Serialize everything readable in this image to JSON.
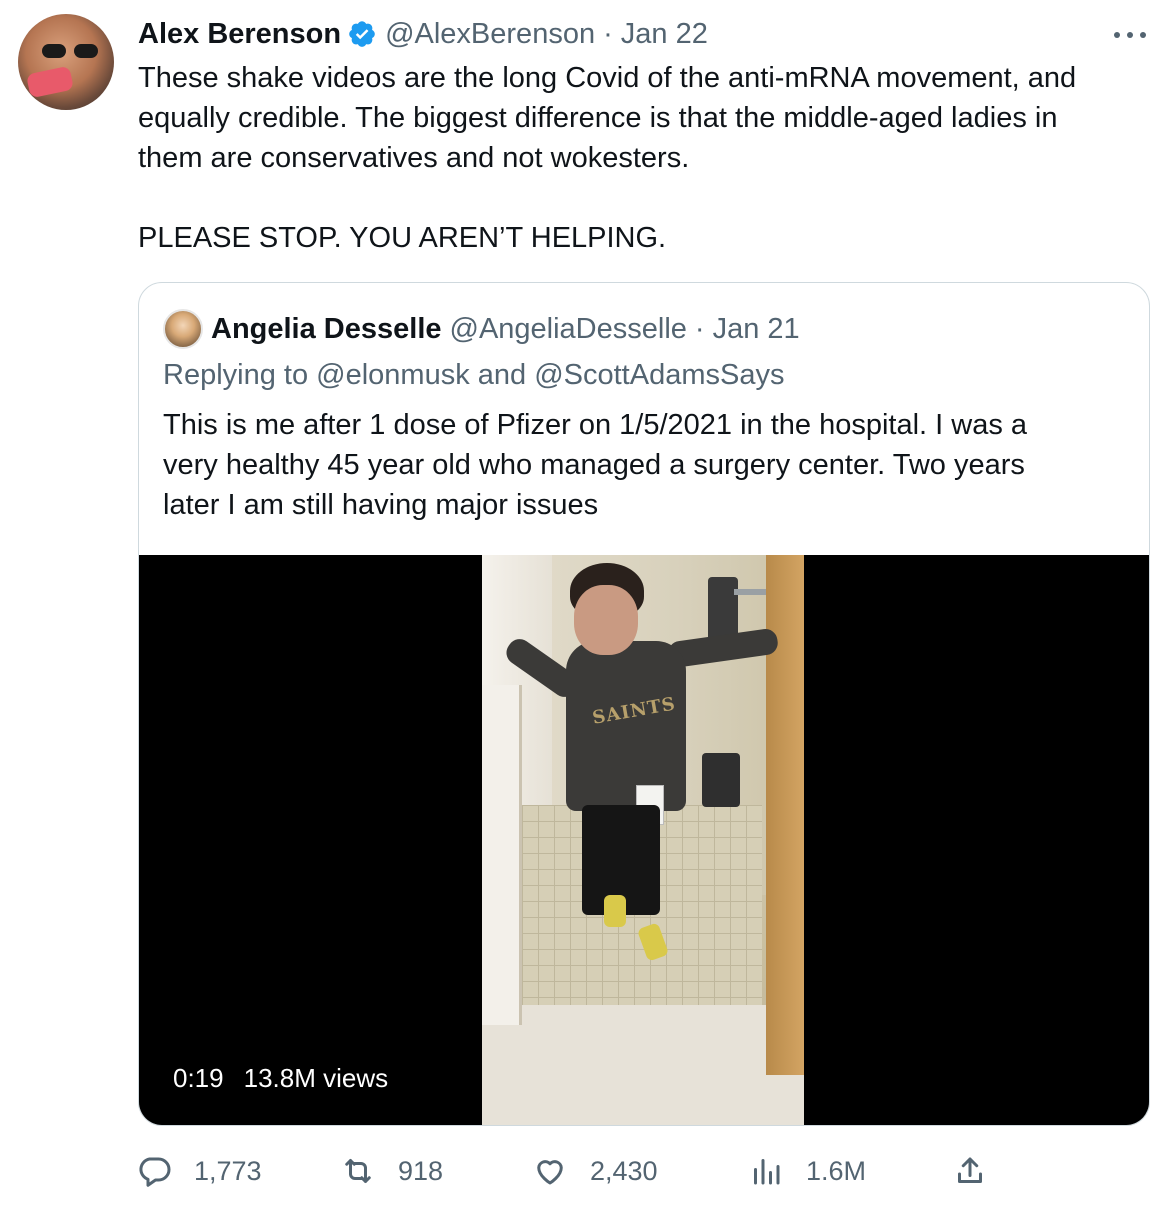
{
  "tweet": {
    "display_name": "Alex Berenson",
    "handle": "@AlexBerenson",
    "separator": "·",
    "date": "Jan 22",
    "text_lines": [
      "These shake videos are the long Covid of the anti-mRNA movement, and",
      "equally credible. The biggest difference is that the middle-aged ladies in",
      "them are conservatives and not wokesters."
    ],
    "text_line_last": "PLEASE STOP. YOU AREN’T HELPING.",
    "verified_color": "#1d9bf0"
  },
  "quoted": {
    "display_name": "Angelia Desselle",
    "handle": "@AngeliaDesselle",
    "separator": "·",
    "date": "Jan 21",
    "replying_prefix": "Replying to ",
    "reply_to_1": "@elonmusk",
    "reply_and": " and ",
    "reply_to_2": "@ScottAdamsSays",
    "text_lines": [
      "This is me after 1 dose of Pfizer on 1/5/2021 in the hospital. I was a",
      "very healthy 45 year old who managed a surgery center.  Two years",
      "later I am still having major issues"
    ],
    "video": {
      "duration": "0:19",
      "views": "13.8M views",
      "shirt_text": "SAINTS"
    }
  },
  "actions": {
    "replies": "1,773",
    "retweets": "918",
    "likes": "2,430",
    "views": "1.6M",
    "icons": [
      "reply-icon",
      "retweet-icon",
      "like-icon",
      "views-icon",
      "share-icon"
    ]
  },
  "colors": {
    "text": "#0f1419",
    "secondary": "#536471",
    "link": "#1d9bf0",
    "border": "#cfd9de"
  }
}
